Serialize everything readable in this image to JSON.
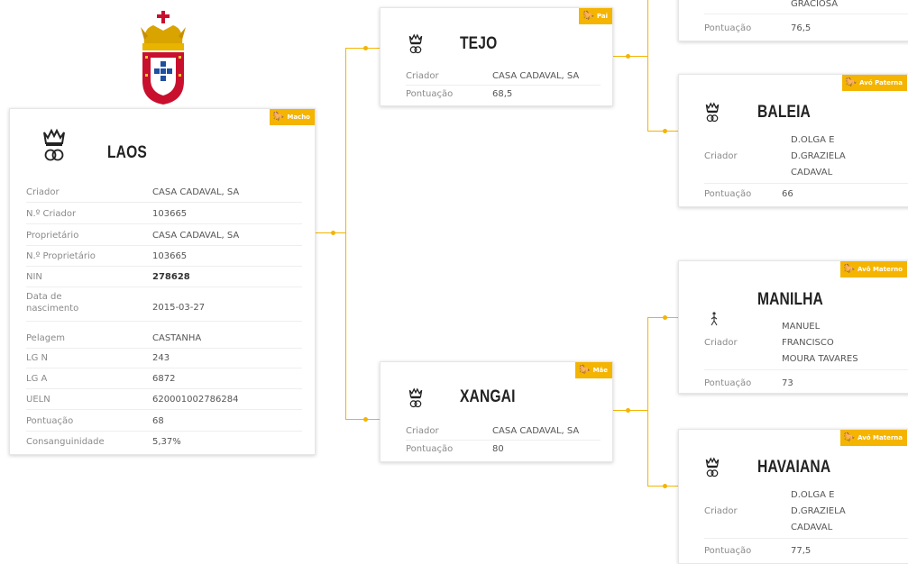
{
  "subject": {
    "badge": "Macho",
    "name": "LAOS",
    "fields": [
      {
        "label": "Criador",
        "value": "CASA CADAVAL, SA"
      },
      {
        "label": "N.º Criador",
        "value": "103665"
      },
      {
        "label": "Proprietário",
        "value": "CASA CADAVAL, SA"
      },
      {
        "label": "N.º Proprietário",
        "value": "103665"
      },
      {
        "label": "NIN",
        "value": "278628"
      },
      {
        "label": "Data de nascimento",
        "value": "2015-03-27"
      },
      {
        "label": "Pelagem",
        "value": "CASTANHA"
      },
      {
        "label": "LG N",
        "value": "243"
      },
      {
        "label": "LG A",
        "value": "6872"
      },
      {
        "label": "UELN",
        "value": "620001002786284"
      },
      {
        "label": "Pontuação",
        "value": "68"
      },
      {
        "label": "Consanguinidade",
        "value": "5,37%"
      }
    ]
  },
  "sire": {
    "badge": "Pai",
    "name": "TEJO",
    "breeder_label": "Criador",
    "breeder": "CASA CADAVAL, SA",
    "score_label": "Pontuação",
    "score": "68,5"
  },
  "dam": {
    "badge": "Mãe",
    "name": "XANGAI",
    "breeder_label": "Criador",
    "breeder": "CASA CADAVAL, SA",
    "score_label": "Pontuação",
    "score": "80"
  },
  "paternal_grandsire": {
    "breeder_partial": "GRACIOSA",
    "score_label": "Pontuação",
    "score": "76,5"
  },
  "paternal_granddam": {
    "badge": "Avó Paterna",
    "name": "BALEIA",
    "breeder_label": "Criador",
    "breeder_lines": [
      "D.OLGA E",
      "D.GRAZIELA",
      "CADAVAL"
    ],
    "score_label": "Pontuação",
    "score": "66"
  },
  "maternal_grandsire": {
    "badge": "Avô Materno",
    "name": "MANILHA",
    "breeder_label": "Criador",
    "breeder_lines": [
      "MANUEL",
      "FRANCISCO",
      "MOURA TAVARES"
    ],
    "score_label": "Pontuação",
    "score": "73"
  },
  "maternal_granddam": {
    "badge": "Avó Materna",
    "name": "HAVAIANA",
    "breeder_label": "Criador",
    "breeder_lines": [
      "D.OLGA E",
      "D.GRAZIELA",
      "CADAVAL"
    ],
    "score_label": "Pontuação",
    "score": "77,5"
  },
  "colors": {
    "accent": "#f4b400",
    "crest_red": "#c8102e"
  }
}
